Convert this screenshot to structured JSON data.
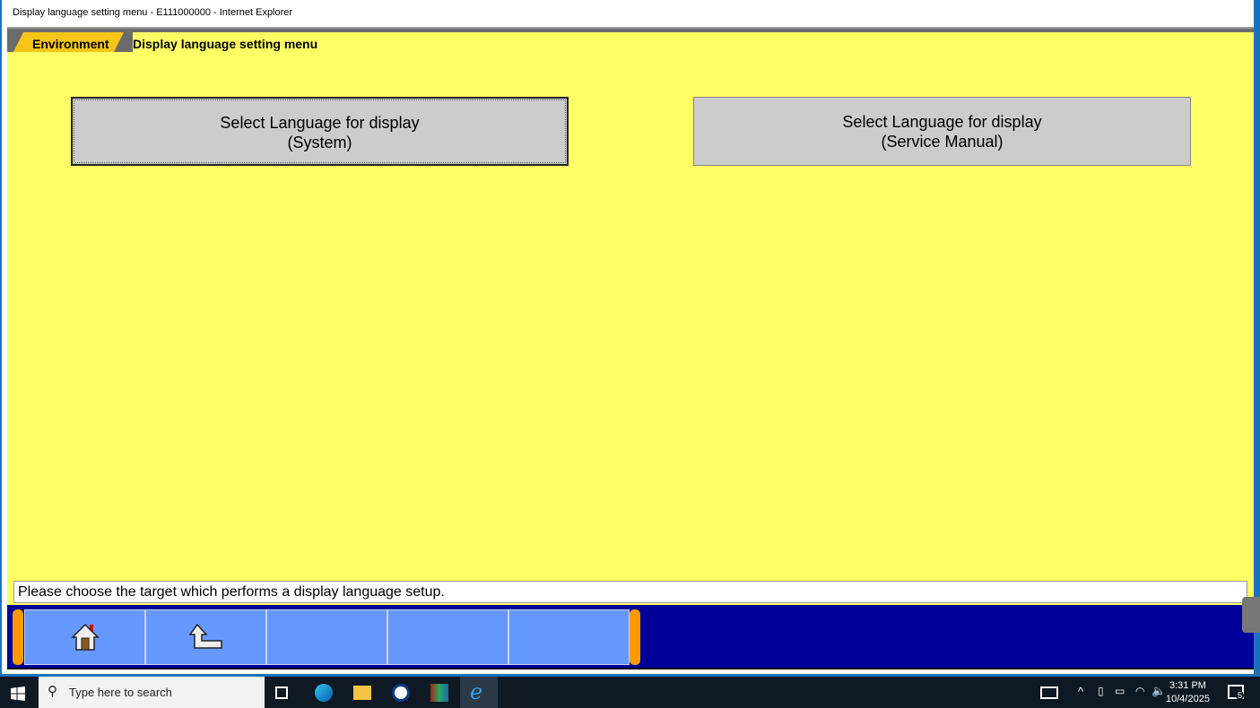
{
  "window": {
    "title": "Display language setting menu - E111000000 - Internet Explorer"
  },
  "header": {
    "breadcrumb": "Environment",
    "title": "Display language setting menu"
  },
  "buttons": [
    {
      "line1": "Select Language for display",
      "line2": "(System)"
    },
    {
      "line1": "Select Language for display",
      "line2": "(Service Manual)"
    }
  ],
  "status": "Please choose the target which performs a display language setup.",
  "function_bar": {
    "icons": [
      "home-icon",
      "back-icon"
    ]
  },
  "taskbar": {
    "search_placeholder": "Type here to search",
    "time": "3:31 PM",
    "date": "10/4/2025",
    "notification_count": "5"
  }
}
